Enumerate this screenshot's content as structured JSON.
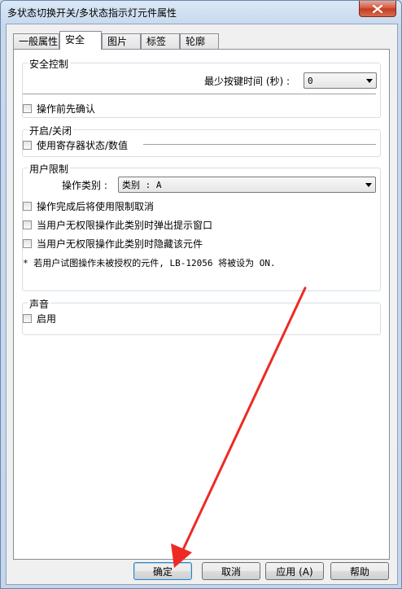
{
  "window": {
    "title": "多状态切换开关/多状态指示灯元件属性"
  },
  "tabs": [
    {
      "label": "一般属性"
    },
    {
      "label": "安全"
    },
    {
      "label": "图片"
    },
    {
      "label": "标签"
    },
    {
      "label": "轮廓"
    }
  ],
  "security": {
    "title": "安全控制",
    "min_press_label": "最少按键时间 (秒) :",
    "min_press_value": "0",
    "confirm_label": "操作前先确认"
  },
  "onoff": {
    "title": "开启/关闭",
    "register_label": "使用寄存器状态/数值"
  },
  "user": {
    "title": "用户限制",
    "category_label": "操作类别 :",
    "category_value": "类别 : A",
    "cancel_after_label": "操作完成后将使用限制取消",
    "popup_label": "当用户无权限操作此类别时弹出提示窗口",
    "hide_label": "当用户无权限操作此类别时隐藏该元件",
    "note": "* 若用户试图操作未被授权的元件, LB-12056 将被设为 ON."
  },
  "sound": {
    "title": "声音",
    "enable_label": "启用"
  },
  "buttons": {
    "ok": "确定",
    "cancel": "取消",
    "apply": "应用 (A)",
    "help": "帮助"
  },
  "colors": {
    "annotation_arrow": "#ee2a24"
  }
}
